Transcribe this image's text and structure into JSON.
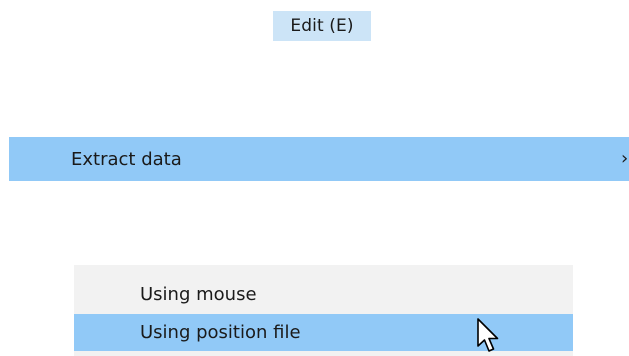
{
  "menubar": {
    "edit_label": "Edit (E)"
  },
  "menu": {
    "extract_label": "Extract data",
    "extract_arrow": "›"
  },
  "submenu": {
    "items": [
      {
        "label": "Using mouse"
      },
      {
        "label": "Using position file"
      }
    ]
  },
  "icons": {
    "cursor": "arrow-cursor-icon"
  },
  "colors": {
    "menubar_highlight": "#cce4f7",
    "item_highlight": "#91c9f7",
    "submenu_bg": "#f2f2f2"
  }
}
